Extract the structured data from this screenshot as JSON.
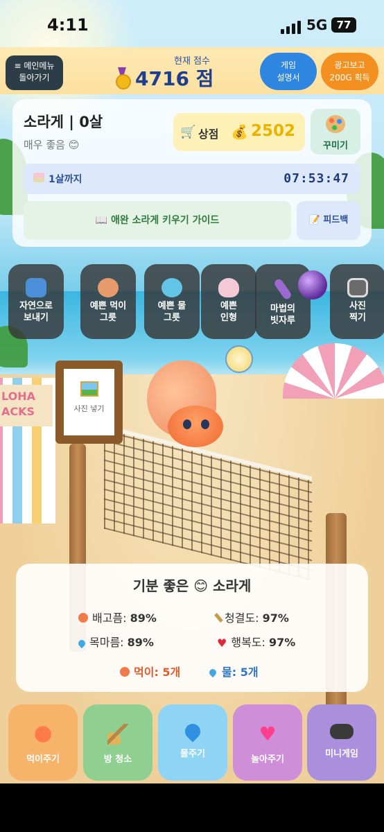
{
  "status_bar": {
    "time": "4:11",
    "network": "5G",
    "battery": "77"
  },
  "header": {
    "menu_button": "≡ 메인메뉴\n돌아가기",
    "menu_line1": "≡ 메인메뉴",
    "menu_line2": "돌아가기",
    "score_label": "현재 점수",
    "score_value": "4716 점",
    "guide_line1": "게임",
    "guide_line2": "설명서",
    "ad_line1": "광고보고",
    "ad_line2": "200G 획득"
  },
  "crab": {
    "name_line": "소라게 | 0살",
    "mood": "매우 좋음 😊",
    "shop_label": "상점",
    "coins": "2502",
    "decorate_label": "꾸미기"
  },
  "birthday": {
    "label": "1살까지",
    "countdown": "07:53:47"
  },
  "links": {
    "care_guide": "📖 애완 소라게 키우기 가이드",
    "feedback": "📝 피드백"
  },
  "items": [
    {
      "line1": "자연으로",
      "line2": "보내기",
      "icon": "wave-icon",
      "color": "#4a8fd8"
    },
    {
      "line1": "예쁜 먹이",
      "line2": "그릇",
      "icon": "food-bowl-icon",
      "color": "#e79a6b"
    },
    {
      "line1": "예쁜 물",
      "line2": "그릇",
      "icon": "water-bowl-icon",
      "color": "#62c4e6"
    },
    {
      "line1": "예쁜",
      "line2": "인형",
      "icon": "bunny-doll-icon",
      "color": "#f4c9d6"
    },
    {
      "line1": "마법의",
      "line2": "빗자루",
      "icon": "magic-broom-icon",
      "color": "#9a6ad0"
    },
    {
      "line1": "사진",
      "line2": "찍기",
      "icon": "camera-icon",
      "color": "#6b6b6b"
    }
  ],
  "photo_slot": {
    "label": "사진 넣기"
  },
  "scene": {
    "stand_sign": "LOHA\nACKS",
    "stand_line1": "LOHA",
    "stand_line2": "ACKS"
  },
  "stats": {
    "title": "기분 좋은 😊 소라게",
    "hunger_label": "배고픔:",
    "hunger_value": "89%",
    "clean_label": "청결도:",
    "clean_value": "97%",
    "thirst_label": "목마름:",
    "thirst_value": "89%",
    "happy_label": "행복도:",
    "happy_value": "97%",
    "food_inventory": "먹이: 5개",
    "water_inventory": "물: 5개"
  },
  "actions": [
    {
      "label": "먹이주기",
      "icon": "shrimp-icon",
      "color": "#f7b36a"
    },
    {
      "label": "방 청소",
      "icon": "broom-icon",
      "color": "#8fcf8f"
    },
    {
      "label": "물주기",
      "icon": "water-drop-icon",
      "color": "#8fd4f5"
    },
    {
      "label": "놀아주기",
      "icon": "hearts-icon",
      "color": "#cf8ed8"
    },
    {
      "label": "미니게임",
      "icon": "gamepad-icon",
      "color": "#a98fdc"
    }
  ]
}
